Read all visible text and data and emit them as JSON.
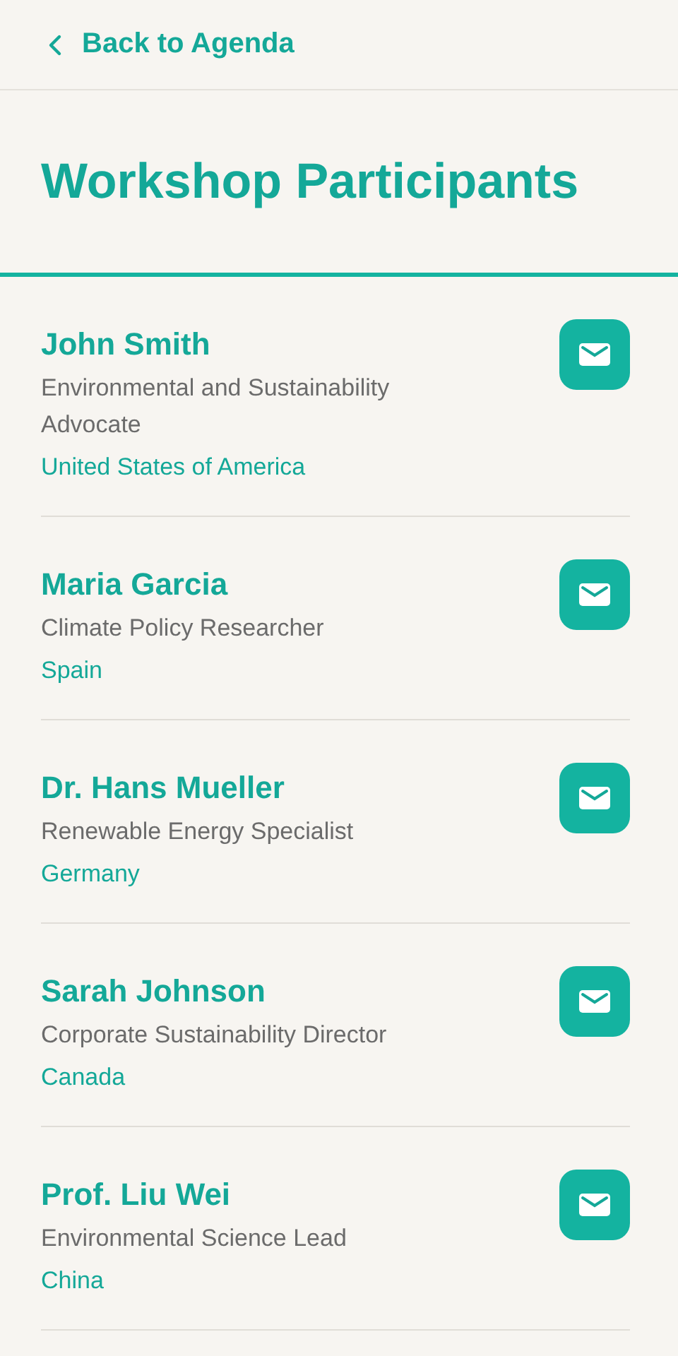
{
  "back_link": {
    "label": "Back to Agenda"
  },
  "title": "Workshop Participants",
  "participants": [
    {
      "name": "John Smith",
      "role": "Environmental and Sustainability Advocate",
      "country": "United States of America"
    },
    {
      "name": "Maria Garcia",
      "role": "Climate Policy Researcher",
      "country": "Spain"
    },
    {
      "name": "Dr. Hans Mueller",
      "role": "Renewable Energy Specialist",
      "country": "Germany"
    },
    {
      "name": "Sarah Johnson",
      "role": "Corporate Sustainability Director",
      "country": "Canada"
    },
    {
      "name": "Prof. Liu Wei",
      "role": "Environmental Science Lead",
      "country": "China"
    }
  ]
}
